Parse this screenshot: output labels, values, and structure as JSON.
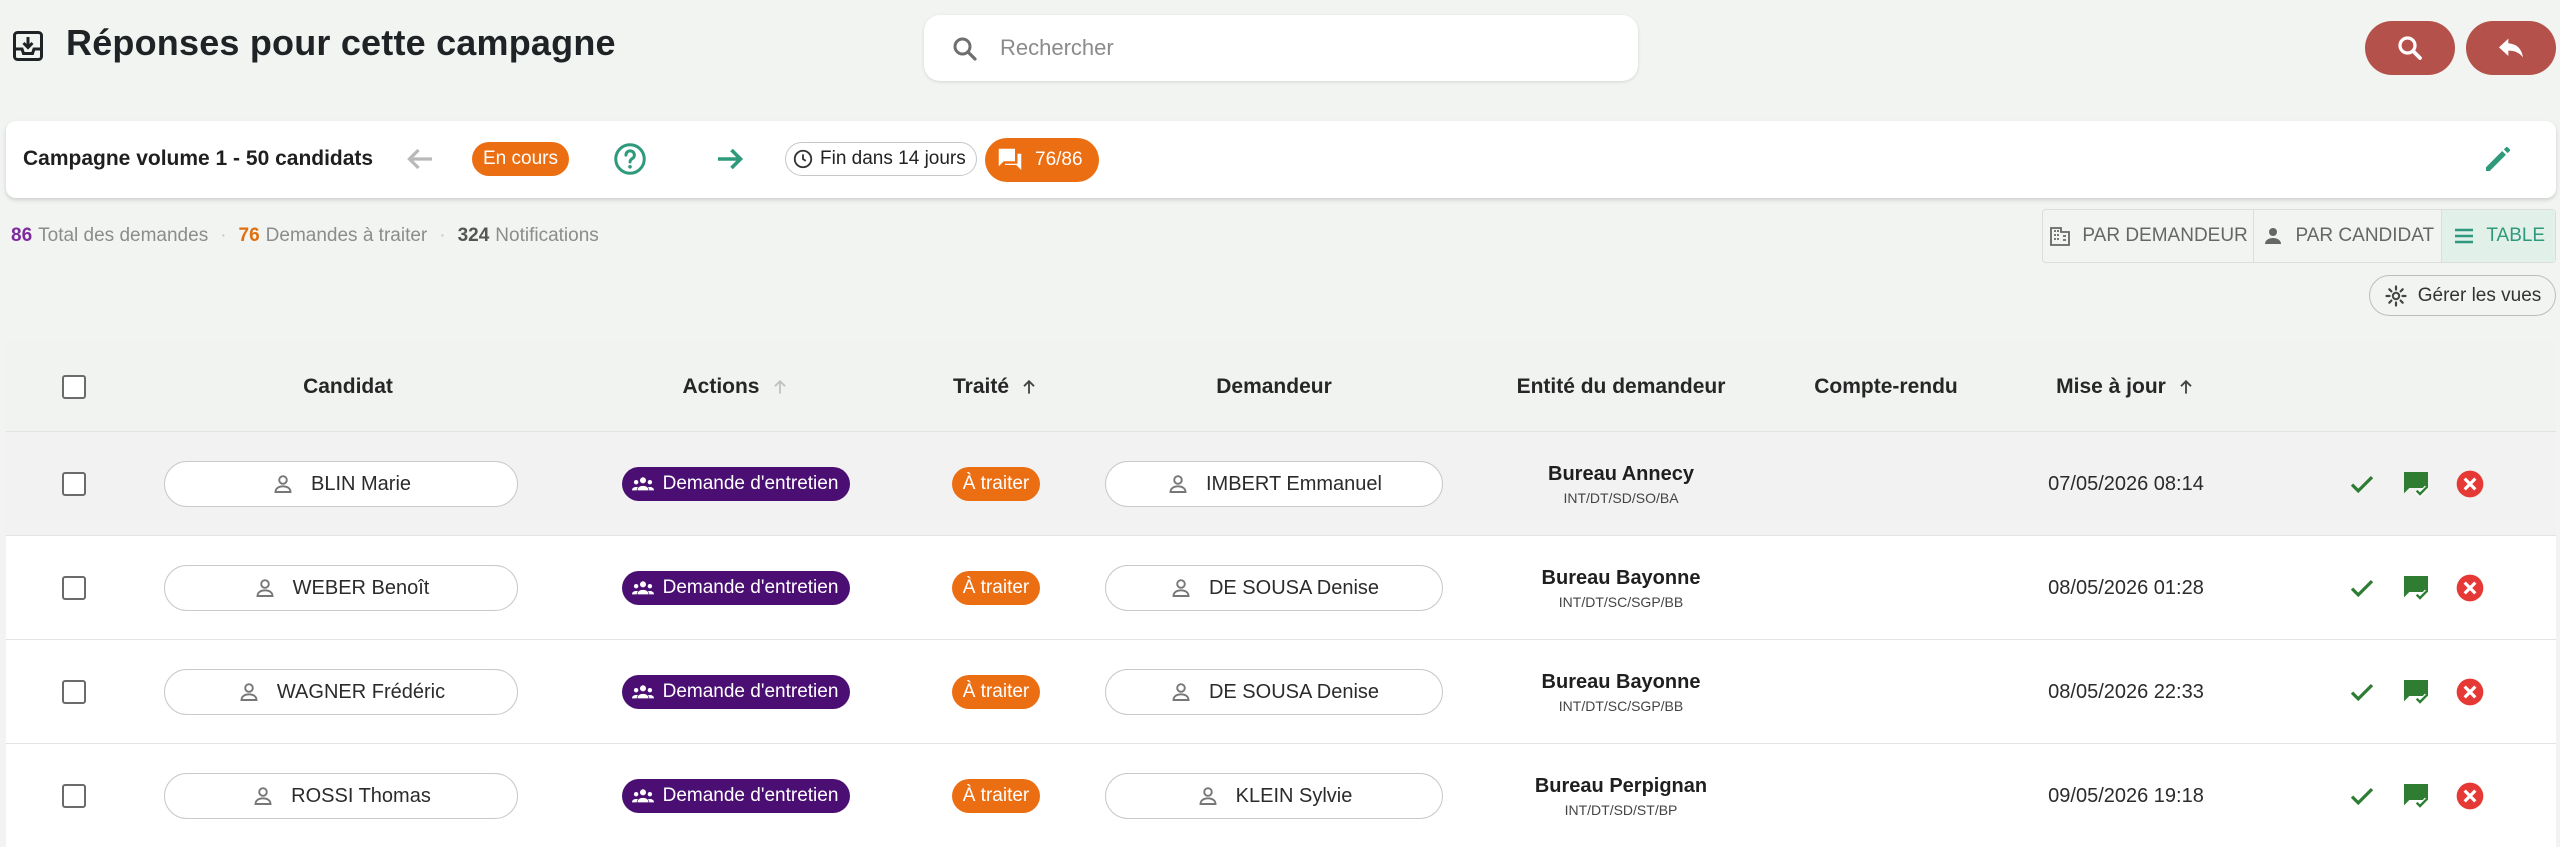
{
  "header": {
    "title": "Réponses pour cette campagne",
    "search_placeholder": "Rechercher",
    "search_value": ""
  },
  "campaign": {
    "name": "Campagne volume 1 - 50 candidats",
    "status": "En cours",
    "deadline": "Fin dans 14 jours",
    "responses": "76/86"
  },
  "stats": {
    "total_num": "86",
    "total_label": "Total des demandes",
    "pending_num": "76",
    "pending_label": "Demandes à traiter",
    "notif_num": "324",
    "notif_label": "Notifications"
  },
  "views": {
    "by_requester": "PAR DEMANDEUR",
    "by_candidate": "PAR CANDIDAT",
    "table": "TABLE",
    "manage": "Gérer les vues"
  },
  "table": {
    "columns": {
      "candidat": "Candidat",
      "actions": "Actions",
      "traite": "Traité",
      "demandeur": "Demandeur",
      "entite": "Entité du demandeur",
      "compte_rendu": "Compte-rendu",
      "mise_a_jour": "Mise à jour"
    },
    "rows": [
      {
        "candidat": "BLIN Marie",
        "action": "Demande d'entretien",
        "traite": "À traiter",
        "demandeur": "IMBERT Emmanuel",
        "entite_name": "Bureau Annecy",
        "entite_code": "INT/DT/SD/SO/BA",
        "compte_rendu": "",
        "date": "07/05/2026 08:14"
      },
      {
        "candidat": "WEBER Benoît",
        "action": "Demande d'entretien",
        "traite": "À traiter",
        "demandeur": "DE SOUSA Denise",
        "entite_name": "Bureau Bayonne",
        "entite_code": "INT/DT/SC/SGP/BB",
        "compte_rendu": "",
        "date": "08/05/2026 01:28"
      },
      {
        "candidat": "WAGNER Frédéric",
        "action": "Demande d'entretien",
        "traite": "À traiter",
        "demandeur": "DE SOUSA Denise",
        "entite_name": "Bureau Bayonne",
        "entite_code": "INT/DT/SC/SGP/BB",
        "compte_rendu": "",
        "date": "08/05/2026 22:33"
      },
      {
        "candidat": "ROSSI Thomas",
        "action": "Demande d'entretien",
        "traite": "À traiter",
        "demandeur": "KLEIN Sylvie",
        "entite_name": "Bureau Perpignan",
        "entite_code": "INT/DT/SD/ST/BP",
        "compte_rendu": "",
        "date": "09/05/2026 19:18"
      }
    ]
  },
  "colors": {
    "accent_orange": "#ec6e12",
    "action_purple": "#4b0f73",
    "brand_red": "#b4514a",
    "teal": "#2e9a7b",
    "green": "#2e7d32",
    "danger_red": "#e53935"
  }
}
